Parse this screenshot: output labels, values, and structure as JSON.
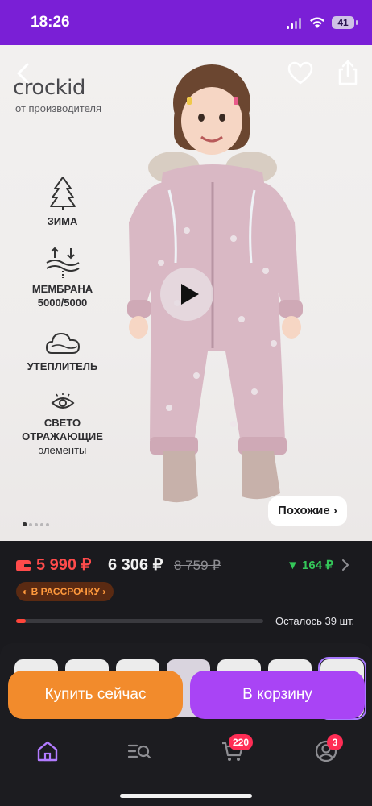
{
  "status_bar": {
    "time": "18:26",
    "battery": "41"
  },
  "hero": {
    "brand": "crockid",
    "brand_sub": "от производителя",
    "features": [
      {
        "label": "ЗИМА"
      },
      {
        "label": "МЕМБРАНА",
        "label2": "5000/5000"
      },
      {
        "label": "УТЕПЛИТЕЛЬ"
      },
      {
        "label": "СВЕТО",
        "label2": "ОТРАЖАЮЩИЕ",
        "label3": "элементы"
      }
    ],
    "similar_label": "Похожие",
    "slides_count": 5,
    "active_slide": 1
  },
  "price": {
    "card_price": "5 990 ₽",
    "price": "6 306 ₽",
    "old_price": "8 759 ₽",
    "discount": "▼ 164 ₽",
    "installment_label": "В РАССРОЧКУ",
    "stock_text": "Осталось 39 шт.",
    "stock_level": 0.04
  },
  "actions": {
    "buy_now": "Купить сейчас",
    "add_to_cart": "В корзину"
  },
  "tabbar": {
    "cart_badge": "220",
    "profile_badge": "3"
  },
  "colors": {
    "status_bar": "#7a1fd6",
    "buy_button": "#f28b2c",
    "cart_button": "#a944f5",
    "card_price": "#ff4b4b",
    "discount": "#34c759",
    "badge": "#ff2d55"
  },
  "icons": [
    "back-chevron-icon",
    "heart-icon",
    "share-icon",
    "tree-icon",
    "membrane-icon",
    "cloud-icon",
    "eye-icon",
    "play-icon",
    "wallet-icon",
    "home-icon",
    "catalog-search-icon",
    "cart-icon",
    "profile-icon"
  ]
}
